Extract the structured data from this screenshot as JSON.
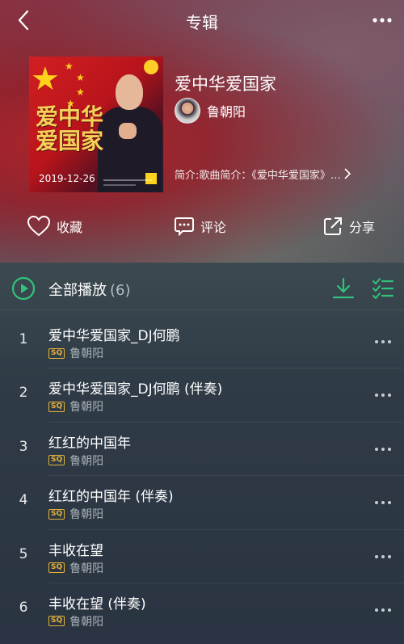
{
  "header": {
    "title": "专辑",
    "back_icon": "chevron-left-icon",
    "more_icon": "more-horizontal-icon"
  },
  "album": {
    "title": "爱中华爱国家",
    "cover_calligraphy": "爱中华爱国家",
    "cover_date": "2019-12-26",
    "artist": "鲁朝阳",
    "intro": "简介:歌曲简介：《爱中华爱国家》…"
  },
  "actions": {
    "favorite": "收藏",
    "comment": "评论",
    "share": "分享"
  },
  "list_header": {
    "play_all": "全部播放",
    "count": "(6)"
  },
  "colors": {
    "accent": "#31c27c",
    "sq_badge": "#e6b23a"
  },
  "tracks": [
    {
      "num": "1",
      "title": "爱中华爱国家_DJ何鹏",
      "quality": "SQ",
      "artist": "鲁朝阳"
    },
    {
      "num": "2",
      "title": "爱中华爱国家_DJ何鹏 (伴奏)",
      "quality": "SQ",
      "artist": "鲁朝阳"
    },
    {
      "num": "3",
      "title": "红红的中国年",
      "quality": "SQ",
      "artist": "鲁朝阳"
    },
    {
      "num": "4",
      "title": "红红的中国年 (伴奏)",
      "quality": "SQ",
      "artist": "鲁朝阳"
    },
    {
      "num": "5",
      "title": "丰收在望",
      "quality": "SQ",
      "artist": "鲁朝阳"
    },
    {
      "num": "6",
      "title": "丰收在望 (伴奏)",
      "quality": "SQ",
      "artist": "鲁朝阳"
    }
  ]
}
